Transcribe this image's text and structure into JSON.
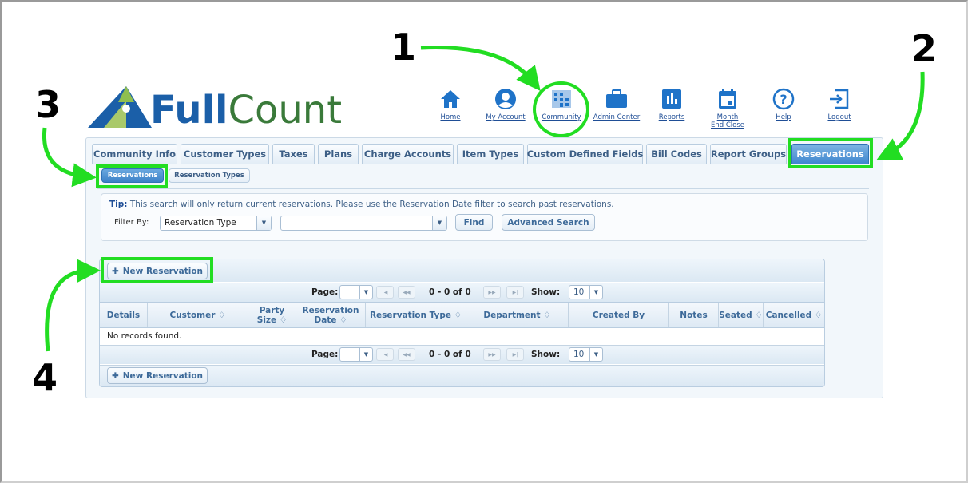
{
  "app": {
    "logo_full": "Full",
    "logo_count": "Count"
  },
  "topnav": [
    {
      "label": "Home",
      "icon": "home-icon"
    },
    {
      "label": "My Account",
      "icon": "account-icon"
    },
    {
      "label": "Community",
      "icon": "community-icon"
    },
    {
      "label": "Admin Center",
      "icon": "briefcase-icon"
    },
    {
      "label": "Reports",
      "icon": "reports-icon"
    },
    {
      "label": "Month End Close",
      "icon": "calendar-icon"
    },
    {
      "label": "Help",
      "icon": "help-icon"
    },
    {
      "label": "Logout",
      "icon": "logout-icon"
    }
  ],
  "tabs": [
    "Community Info",
    "Customer Types",
    "Taxes",
    "Plans",
    "Charge Accounts",
    "Item Types",
    "Custom Defined Fields",
    "Bill Codes",
    "Report Groups",
    "Reservations"
  ],
  "subtabs": [
    "Reservations",
    "Reservation Types"
  ],
  "filter": {
    "tip_bold": "Tip:",
    "tip_text": " This search will only return current reservations. Please use the Reservation Date filter to search past reservations.",
    "filter_by_label": "Filter By:",
    "filter_type_value": "Reservation Type",
    "filter_value": "",
    "find_label": "Find",
    "advanced_label": "Advanced Search"
  },
  "grid": {
    "new_reservation_label": "New Reservation",
    "page_label": "Page:",
    "range_text": "0 - 0 of 0",
    "show_label": "Show:",
    "show_value": "10",
    "columns": [
      "Details",
      "Customer ♢",
      "Party Size ♢",
      "Reservation Date ♢",
      "Reservation Type ♢",
      "Department ♢",
      "Created By",
      "Notes",
      "Seated ♢",
      "Cancelled ♢"
    ],
    "empty_text": "No records found."
  },
  "annotations": [
    "1",
    "2",
    "3",
    "4"
  ],
  "colors": {
    "brand_blue": "#1b5fa8",
    "brand_green": "#3a7a3a",
    "highlight_green": "#22dd22",
    "active_tab": "#3f86cf"
  }
}
